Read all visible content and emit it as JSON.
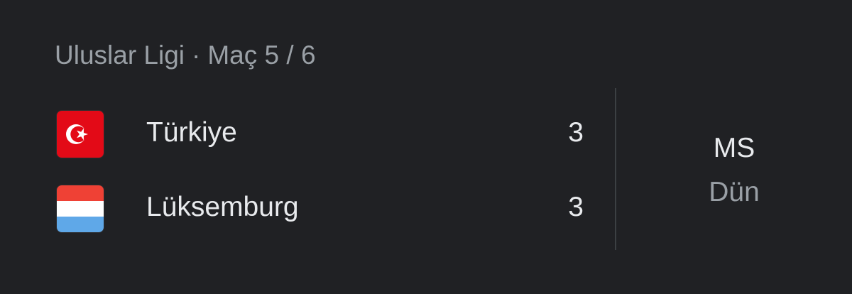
{
  "match": {
    "competition": "Uluslar Ligi",
    "separator": "·",
    "matchday": "Maç 5 / 6",
    "teams": [
      {
        "name": "Türkiye",
        "score": "3",
        "flag": "turkey-flag-icon"
      },
      {
        "name": "Lüksemburg",
        "score": "3",
        "flag": "luxembourg-flag-icon"
      }
    ],
    "status": "MS",
    "time": "Dün"
  },
  "colors": {
    "background": "#202124",
    "primary_text": "#e8eaed",
    "secondary_text": "#9aa0a6",
    "divider": "#3c4043",
    "turkey_red": "#e30a17",
    "lux_red": "#ef4135",
    "lux_blue": "#5fa8e8"
  }
}
